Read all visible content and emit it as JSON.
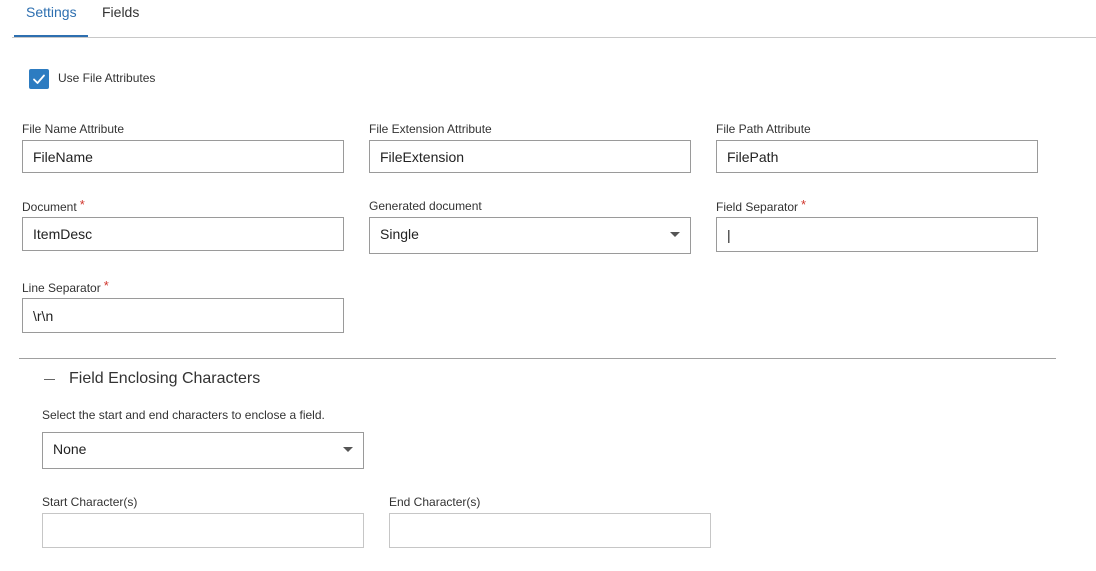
{
  "tabs": [
    {
      "label": "Settings",
      "active": true
    },
    {
      "label": "Fields",
      "active": false
    }
  ],
  "use_file_attributes": {
    "label": "Use File Attributes",
    "checked": true
  },
  "fields": {
    "file_name_attribute": {
      "label": "File Name Attribute",
      "value": "FileName"
    },
    "file_extension_attribute": {
      "label": "File Extension Attribute",
      "value": "FileExtension"
    },
    "file_path_attribute": {
      "label": "File Path Attribute",
      "value": "FilePath"
    },
    "document": {
      "label": "Document",
      "value": "ItemDesc",
      "required": true
    },
    "generated_document": {
      "label": "Generated document",
      "value": "Single"
    },
    "field_separator": {
      "label": "Field Separator",
      "value": "|",
      "required": true
    },
    "line_separator": {
      "label": "Line Separator",
      "value": "\\r\\n",
      "required": true
    }
  },
  "required_marker": "*",
  "field_enclosing": {
    "title": "Field Enclosing Characters",
    "description": "Select the start and end characters to enclose a field.",
    "selected": "None",
    "start_label": "Start Character(s)",
    "start_value": "",
    "end_label": "End Character(s)",
    "end_value": ""
  },
  "colors": {
    "accent": "#2d6fb0",
    "checkbox": "#2d7cc1",
    "required": "#d0352c"
  },
  "icons": {
    "checkbox_check": "check-icon",
    "dropdown": "chevron-down-icon",
    "collapse": "minus-icon"
  }
}
